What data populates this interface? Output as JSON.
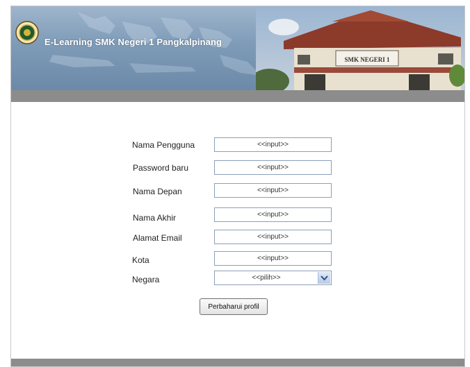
{
  "header": {
    "title": "E-Learning SMK Negeri 1 Pangkalpinang",
    "logo_icon": "school-emblem-icon",
    "building_sign": "SMK NEGERI 1"
  },
  "colors": {
    "banner_blue": "#7e9bb8",
    "bar_gray": "#8c8c8c",
    "field_border": "#8b9fb8"
  },
  "form": {
    "fields": [
      {
        "label": "Nama Pengguna",
        "value": "<<input>>"
      },
      {
        "label": "Password baru",
        "value": "<<input>>"
      },
      {
        "label": "Nama Depan",
        "value": "<<input>>"
      },
      {
        "label": "Nama Akhir",
        "value": "<<input>>"
      },
      {
        "label": "Alamat Email",
        "value": "<<input>>"
      },
      {
        "label": "Kota",
        "value": "<<input>>"
      }
    ],
    "country": {
      "label": "Negara",
      "value": "<<pilih>>",
      "icon": "chevron-down-icon"
    },
    "submit_label": "Perbaharui profil"
  }
}
